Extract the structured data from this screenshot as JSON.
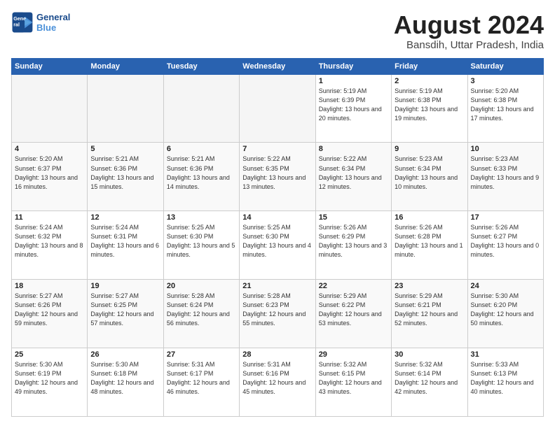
{
  "logo": {
    "line1": "General",
    "line2": "Blue"
  },
  "title": "August 2024",
  "subtitle": "Bansdih, Uttar Pradesh, India",
  "weekdays": [
    "Sunday",
    "Monday",
    "Tuesday",
    "Wednesday",
    "Thursday",
    "Friday",
    "Saturday"
  ],
  "weeks": [
    [
      {
        "day": "",
        "detail": ""
      },
      {
        "day": "",
        "detail": ""
      },
      {
        "day": "",
        "detail": ""
      },
      {
        "day": "",
        "detail": ""
      },
      {
        "day": "1",
        "detail": "Sunrise: 5:19 AM\nSunset: 6:39 PM\nDaylight: 13 hours\nand 20 minutes."
      },
      {
        "day": "2",
        "detail": "Sunrise: 5:19 AM\nSunset: 6:38 PM\nDaylight: 13 hours\nand 19 minutes."
      },
      {
        "day": "3",
        "detail": "Sunrise: 5:20 AM\nSunset: 6:38 PM\nDaylight: 13 hours\nand 17 minutes."
      }
    ],
    [
      {
        "day": "4",
        "detail": "Sunrise: 5:20 AM\nSunset: 6:37 PM\nDaylight: 13 hours\nand 16 minutes."
      },
      {
        "day": "5",
        "detail": "Sunrise: 5:21 AM\nSunset: 6:36 PM\nDaylight: 13 hours\nand 15 minutes."
      },
      {
        "day": "6",
        "detail": "Sunrise: 5:21 AM\nSunset: 6:36 PM\nDaylight: 13 hours\nand 14 minutes."
      },
      {
        "day": "7",
        "detail": "Sunrise: 5:22 AM\nSunset: 6:35 PM\nDaylight: 13 hours\nand 13 minutes."
      },
      {
        "day": "8",
        "detail": "Sunrise: 5:22 AM\nSunset: 6:34 PM\nDaylight: 13 hours\nand 12 minutes."
      },
      {
        "day": "9",
        "detail": "Sunrise: 5:23 AM\nSunset: 6:34 PM\nDaylight: 13 hours\nand 10 minutes."
      },
      {
        "day": "10",
        "detail": "Sunrise: 5:23 AM\nSunset: 6:33 PM\nDaylight: 13 hours\nand 9 minutes."
      }
    ],
    [
      {
        "day": "11",
        "detail": "Sunrise: 5:24 AM\nSunset: 6:32 PM\nDaylight: 13 hours\nand 8 minutes."
      },
      {
        "day": "12",
        "detail": "Sunrise: 5:24 AM\nSunset: 6:31 PM\nDaylight: 13 hours\nand 6 minutes."
      },
      {
        "day": "13",
        "detail": "Sunrise: 5:25 AM\nSunset: 6:30 PM\nDaylight: 13 hours\nand 5 minutes."
      },
      {
        "day": "14",
        "detail": "Sunrise: 5:25 AM\nSunset: 6:30 PM\nDaylight: 13 hours\nand 4 minutes."
      },
      {
        "day": "15",
        "detail": "Sunrise: 5:26 AM\nSunset: 6:29 PM\nDaylight: 13 hours\nand 3 minutes."
      },
      {
        "day": "16",
        "detail": "Sunrise: 5:26 AM\nSunset: 6:28 PM\nDaylight: 13 hours\nand 1 minute."
      },
      {
        "day": "17",
        "detail": "Sunrise: 5:26 AM\nSunset: 6:27 PM\nDaylight: 13 hours\nand 0 minutes."
      }
    ],
    [
      {
        "day": "18",
        "detail": "Sunrise: 5:27 AM\nSunset: 6:26 PM\nDaylight: 12 hours\nand 59 minutes."
      },
      {
        "day": "19",
        "detail": "Sunrise: 5:27 AM\nSunset: 6:25 PM\nDaylight: 12 hours\nand 57 minutes."
      },
      {
        "day": "20",
        "detail": "Sunrise: 5:28 AM\nSunset: 6:24 PM\nDaylight: 12 hours\nand 56 minutes."
      },
      {
        "day": "21",
        "detail": "Sunrise: 5:28 AM\nSunset: 6:23 PM\nDaylight: 12 hours\nand 55 minutes."
      },
      {
        "day": "22",
        "detail": "Sunrise: 5:29 AM\nSunset: 6:22 PM\nDaylight: 12 hours\nand 53 minutes."
      },
      {
        "day": "23",
        "detail": "Sunrise: 5:29 AM\nSunset: 6:21 PM\nDaylight: 12 hours\nand 52 minutes."
      },
      {
        "day": "24",
        "detail": "Sunrise: 5:30 AM\nSunset: 6:20 PM\nDaylight: 12 hours\nand 50 minutes."
      }
    ],
    [
      {
        "day": "25",
        "detail": "Sunrise: 5:30 AM\nSunset: 6:19 PM\nDaylight: 12 hours\nand 49 minutes."
      },
      {
        "day": "26",
        "detail": "Sunrise: 5:30 AM\nSunset: 6:18 PM\nDaylight: 12 hours\nand 48 minutes."
      },
      {
        "day": "27",
        "detail": "Sunrise: 5:31 AM\nSunset: 6:17 PM\nDaylight: 12 hours\nand 46 minutes."
      },
      {
        "day": "28",
        "detail": "Sunrise: 5:31 AM\nSunset: 6:16 PM\nDaylight: 12 hours\nand 45 minutes."
      },
      {
        "day": "29",
        "detail": "Sunrise: 5:32 AM\nSunset: 6:15 PM\nDaylight: 12 hours\nand 43 minutes."
      },
      {
        "day": "30",
        "detail": "Sunrise: 5:32 AM\nSunset: 6:14 PM\nDaylight: 12 hours\nand 42 minutes."
      },
      {
        "day": "31",
        "detail": "Sunrise: 5:33 AM\nSunset: 6:13 PM\nDaylight: 12 hours\nand 40 minutes."
      }
    ]
  ]
}
